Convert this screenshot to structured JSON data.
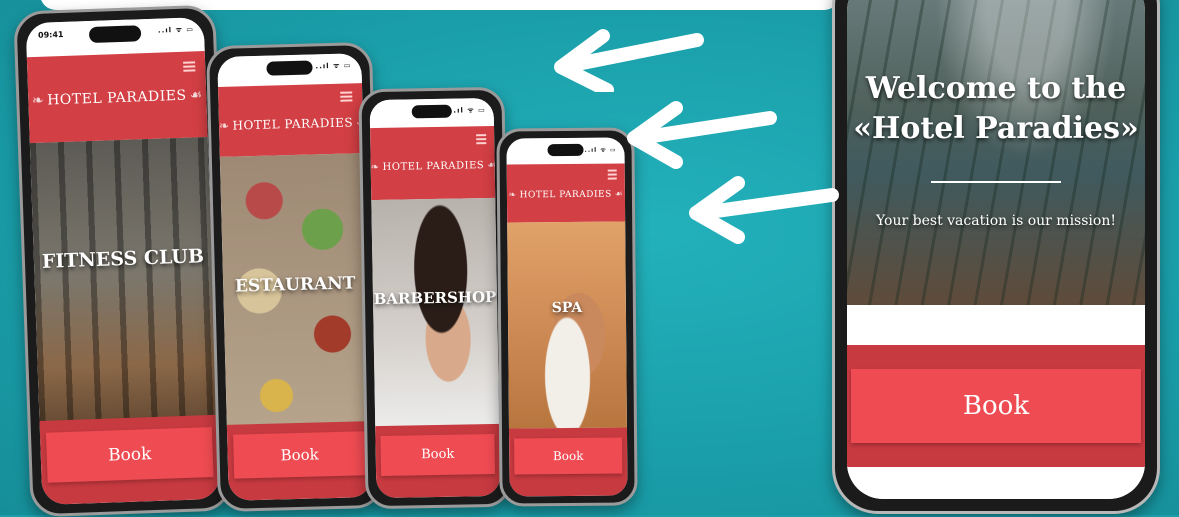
{
  "status_time": "09:41",
  "status_icons": "..ıl ᯤ ▭",
  "brand": "HOTEL PARADIES",
  "screens": [
    {
      "title": "FITNESS CLUB",
      "button": "Book"
    },
    {
      "title": "ESTAURANT",
      "button": "Book"
    },
    {
      "title": "BARBERSHOP",
      "button": "Book"
    },
    {
      "title": "SPA",
      "button": "Book"
    }
  ],
  "hero": {
    "heading_line1": "Welcome to the",
    "heading_line2": "«Hotel Paradies»",
    "subtitle": "Your best vacation is our mission!",
    "button": "Book"
  },
  "icons": [
    "menu-icon",
    "arrow-left-icon"
  ],
  "colors": {
    "background": "#1a9faa",
    "brand_red": "#d23f44",
    "button_red": "#ef4b52"
  }
}
